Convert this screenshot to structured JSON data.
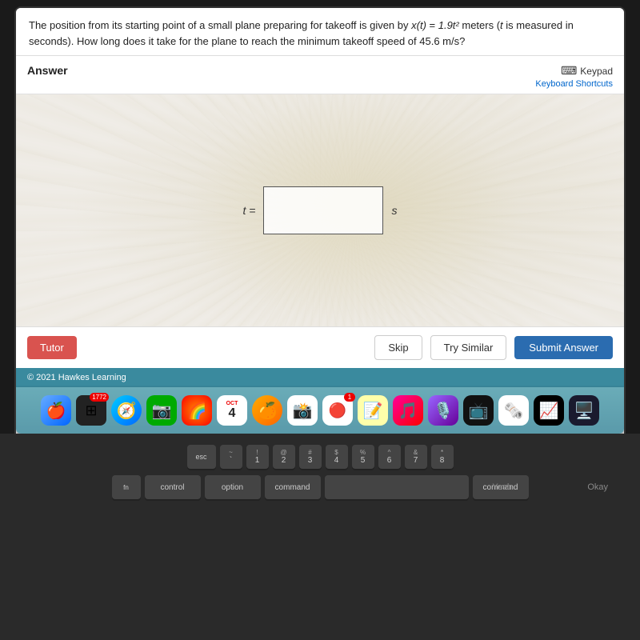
{
  "question": {
    "text": "The position from its starting point of a small plane preparing for takeoff is given by x(t) = 1.9t² meters (t is measured in seconds). How long does it take for the plane to reach the minimum takeoff speed of 45.6 m/s?"
  },
  "answer": {
    "label": "Answer",
    "keypad_label": "Keypad",
    "keyboard_shortcuts_label": "Keyboard Shortcuts",
    "equation_prefix": "t =",
    "unit_suffix": "s",
    "input_placeholder": ""
  },
  "buttons": {
    "tutor": "Tutor",
    "skip": "Skip",
    "try_similar": "Try Similar",
    "submit": "Submit Answer"
  },
  "copyright": "© 2021 Hawkes Learning",
  "dock": {
    "icons": [
      {
        "symbol": "🍎",
        "label": "finder"
      },
      {
        "symbol": "⬛",
        "label": "launchpad",
        "badge": ""
      },
      {
        "symbol": "🧭",
        "label": "safari"
      },
      {
        "symbol": "📷",
        "label": "facetime"
      },
      {
        "symbol": "🌈",
        "label": "launchpad2",
        "badge": "1772"
      },
      {
        "symbol": "📊",
        "label": "calendar",
        "date": "4"
      },
      {
        "symbol": "🍊",
        "label": "macos"
      },
      {
        "symbol": "📸",
        "label": "photos"
      },
      {
        "symbol": "🔴",
        "label": "reminders",
        "badge": "1"
      },
      {
        "symbol": "⬛",
        "label": "notes"
      },
      {
        "symbol": "🎵",
        "label": "music"
      },
      {
        "symbol": "🎙️",
        "label": "podcasts"
      },
      {
        "symbol": "📺",
        "label": "appletv"
      },
      {
        "symbol": "🔴",
        "label": "news"
      },
      {
        "symbol": "📶",
        "label": "stocks"
      },
      {
        "symbol": "🖥️",
        "label": "terminal"
      }
    ]
  },
  "keyboard": {
    "rows": [
      [
        "esc",
        "~\n`",
        "!\n1",
        "@\n2",
        "#\n3",
        "$\n4",
        "%\n5",
        "^\n6",
        "&\n7",
        "*\n8"
      ],
      [
        "Yeah",
        "Okay"
      ]
    ]
  }
}
